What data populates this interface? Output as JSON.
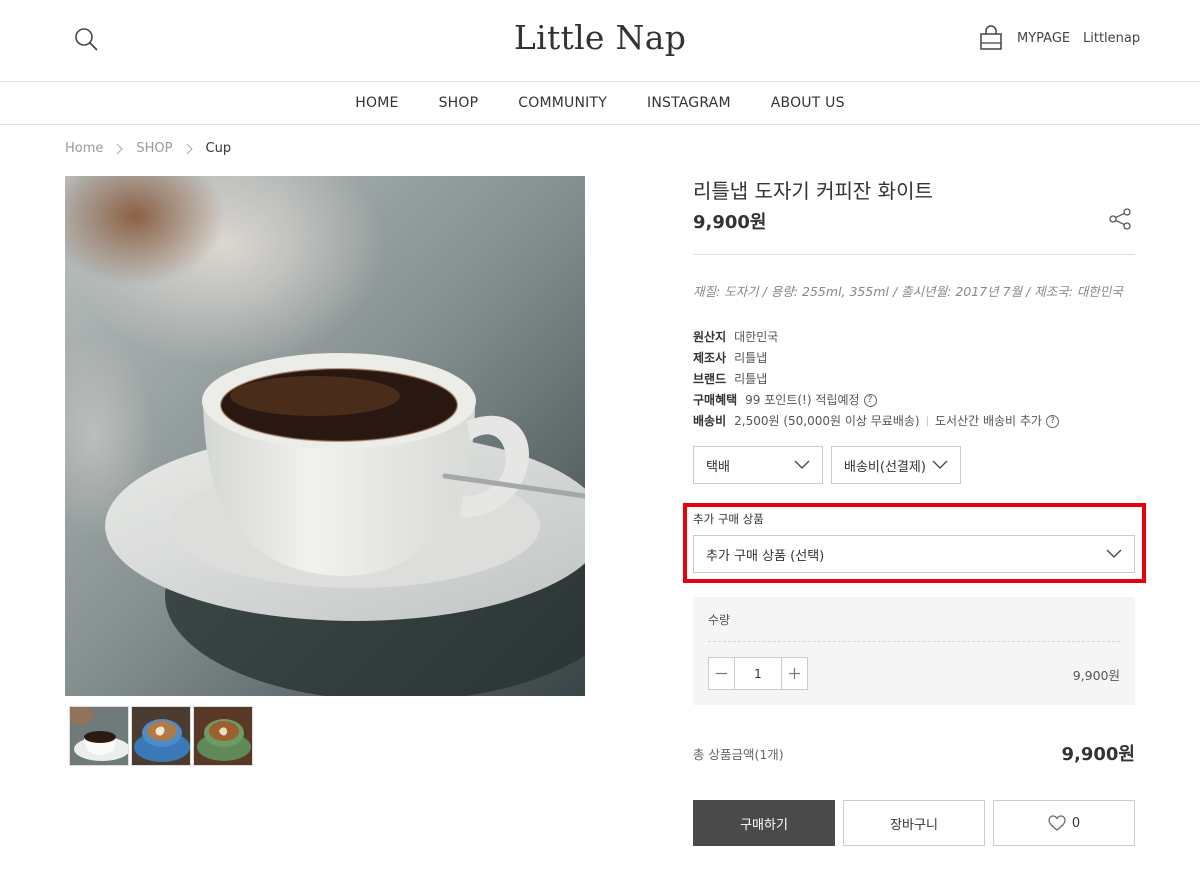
{
  "header": {
    "logo": "Little Nap",
    "mypage": "MYPAGE",
    "username": "Littlenap"
  },
  "nav": [
    "HOME",
    "SHOP",
    "COMMUNITY",
    "INSTAGRAM",
    "ABOUT US"
  ],
  "breadcrumb": [
    "Home",
    "SHOP",
    "Cup"
  ],
  "product": {
    "name": "리틀냅 도자기 커피잔 화이트",
    "price": "9,900원",
    "description": "재질: 도자기 / 용량: 255ml, 355ml / 출시년월: 2017년 7월 / 제조국: 대한민국",
    "specs": [
      {
        "label": "원산지",
        "value": "대한민국"
      },
      {
        "label": "제조사",
        "value": "리틀냅"
      },
      {
        "label": "브랜드",
        "value": "리틀냅"
      },
      {
        "label": "구매혜택",
        "value": "99 포인트(!) 적립예정"
      },
      {
        "label": "배송비",
        "value": "2,500원 (50,000원 이상 무료배송)",
        "extra": "도서산간 배송비 추가"
      }
    ]
  },
  "options": {
    "shipping_method": "택배",
    "shipping_fee": "배송비(선결제)",
    "addon_label": "추가 구매 상품",
    "addon_select": "추가 구매 상품 (선택)"
  },
  "quantity": {
    "label": "수량",
    "value": "1",
    "line_price": "9,900원"
  },
  "total": {
    "label": "총 상품금액(1개)",
    "price": "9,900원"
  },
  "buttons": {
    "buy": "구매하기",
    "cart": "장바구니",
    "wish_count": "0"
  },
  "icons": [
    "search-icon",
    "shopping-bag-icon",
    "share-icon",
    "chevron-right-icon",
    "chevron-down-icon",
    "question-icon",
    "minus-icon",
    "plus-icon",
    "heart-icon"
  ],
  "colors": {
    "highlight": "#e8000b",
    "buy_button": "#4a4a4a"
  }
}
